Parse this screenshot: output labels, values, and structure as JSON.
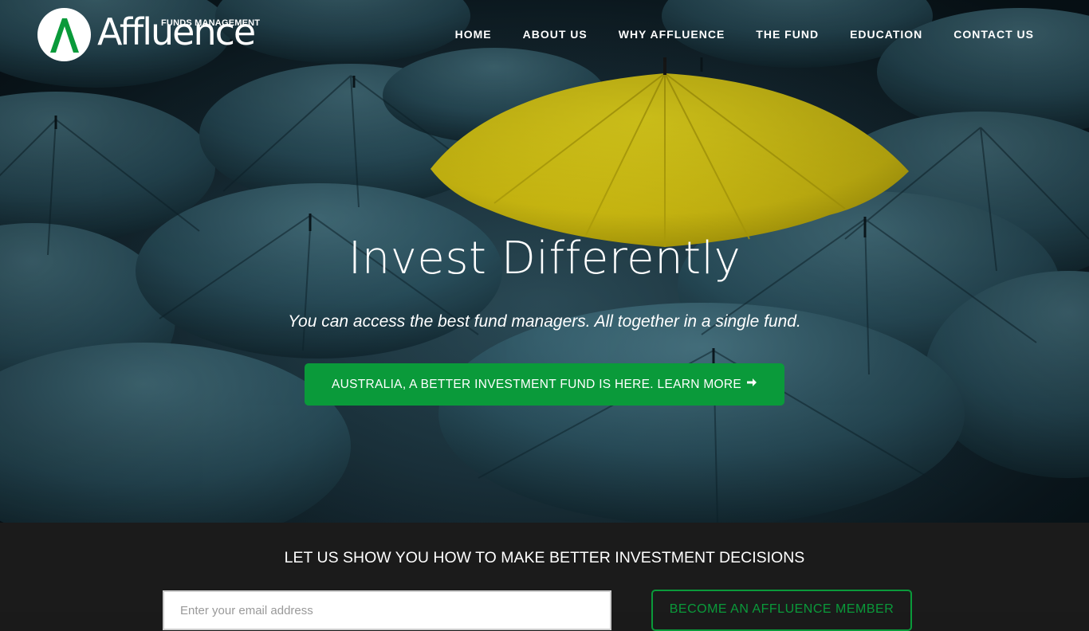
{
  "brand": {
    "name": "Affluence",
    "sub": "FUNDS MANAGEMENT",
    "accent": "#0a9a3a"
  },
  "nav": {
    "items": [
      "HOME",
      "ABOUT US",
      "WHY AFFLUENCE",
      "THE FUND",
      "EDUCATION",
      "CONTACT US"
    ]
  },
  "hero": {
    "headline": "Invest Differently",
    "tagline": "You can access the best fund managers. All together in a single fund.",
    "cta_label": "AUSTRALIA, A BETTER INVESTMENT FUND IS HERE. LEARN MORE",
    "cta_icon": "arrow-right-icon"
  },
  "signup": {
    "title": "LET US SHOW YOU HOW TO MAKE BETTER INVESTMENT DECISIONS",
    "email_placeholder": "Enter your email address",
    "member_button": "BECOME AN AFFLUENCE MEMBER"
  }
}
